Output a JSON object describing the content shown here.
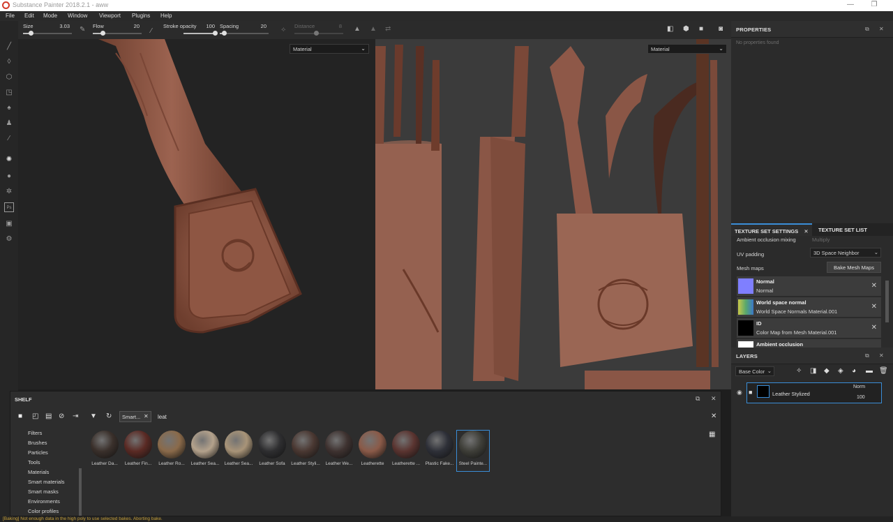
{
  "window": {
    "title": "Substance Painter 2018.2.1 - aww",
    "min_icon": "minimize-icon",
    "restore_icon": "restore-icon"
  },
  "menu": [
    "File",
    "Edit",
    "Mode",
    "Window",
    "Viewport",
    "Plugins",
    "Help"
  ],
  "toolprops": {
    "size_label": "Size",
    "size_value": "3.03",
    "size_level": 0.15,
    "flow_label": "Flow",
    "flow_value": "20",
    "flow_level": 0.2,
    "opacity_label": "Stroke opacity",
    "opacity_value": "100",
    "opacity_level": 1.0,
    "spacing_label": "Spacing",
    "spacing_value": "20",
    "spacing_level": 0.08,
    "distance_label": "Distance",
    "distance_value": "8"
  },
  "viewport3d": {
    "channel": "Material"
  },
  "viewport2d": {
    "channel": "Material"
  },
  "properties": {
    "title": "PROPERTIES",
    "empty_text": "No properties found"
  },
  "texture_set": {
    "tab_settings": "TEXTURE SET SETTINGS",
    "tab_list": "TEXTURE SET LIST",
    "ao_mixing_label": "Ambient occlusion mixing",
    "ao_mixing_value": "Multiply",
    "uv_padding_label": "UV padding",
    "uv_padding_value": "3D Space Neighbor",
    "mesh_maps_label": "Mesh maps",
    "bake_button": "Bake Mesh Maps",
    "maps": [
      {
        "title": "Normal",
        "sub": "Normal",
        "color": "#7f7fff"
      },
      {
        "title": "World space normal",
        "sub": "World Space Normals Material.001",
        "color": "#5aa86b"
      },
      {
        "title": "ID",
        "sub": "Color Map from Mesh Material.001",
        "color": "#000000"
      },
      {
        "title": "Ambient occlusion",
        "sub": "",
        "color": "#ffffff"
      }
    ]
  },
  "layers": {
    "title": "LAYERS",
    "channel": "Base Color",
    "items": [
      {
        "name": "Leather Stylized",
        "blend": "Norm",
        "opacity": "100"
      }
    ]
  },
  "shelf": {
    "title": "SHELF",
    "filter_tag": "Smart...",
    "search_value": "leat",
    "categories": [
      "Filters",
      "Brushes",
      "Particles",
      "Tools",
      "Materials",
      "Smart materials",
      "Smart masks",
      "Environments",
      "Color profiles"
    ],
    "materials": [
      {
        "label": "Leather Da...",
        "color": "#3a302b"
      },
      {
        "label": "Leather Fin...",
        "color": "#5a2a24"
      },
      {
        "label": "Leather Ro...",
        "color": "#8a6a4a"
      },
      {
        "label": "Leather Sea...",
        "color": "#b4a28c"
      },
      {
        "label": "Leather Sea...",
        "color": "#a89478"
      },
      {
        "label": "Leather Sofa",
        "color": "#2e2e30"
      },
      {
        "label": "Leather Styli...",
        "color": "#4a3832"
      },
      {
        "label": "Leather We...",
        "color": "#3e3230"
      },
      {
        "label": "Leatherette",
        "color": "#8a5a48"
      },
      {
        "label": "Leatherette ...",
        "color": "#5a3430"
      },
      {
        "label": "Plastic Fake...",
        "color": "#2e3038"
      },
      {
        "label": "Steel Painte...",
        "color": "#3e3e38"
      }
    ]
  },
  "status": "[Baking] Not enough data in the high poly to use selected bakes. Aborting bake."
}
